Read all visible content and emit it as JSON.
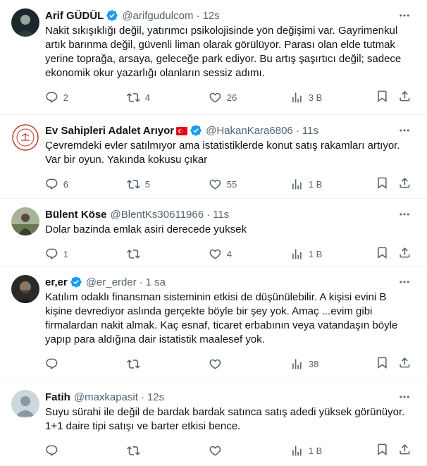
{
  "tweets": [
    {
      "name": "Arif GÜDÜL",
      "handle": "@arifgudulcom",
      "time": "12s",
      "verified": true,
      "text": "Nakit sıkışıklığı değil, yatırımcı psikolojisinde yön değişimi var. Gayrimenkul artık barınma değil, güvenli liman olarak görülüyor. Parası olan elde tutmak yerine toprağa, arsaya, geleceğe park ediyor. Bu artış şaşırtıcı değil; sadece ekonomik okur yazarlığı olanların sessiz adımı.",
      "replies": "2",
      "retweets": "4",
      "likes": "26",
      "views": "3 B"
    },
    {
      "name": "Ev Sahipleri Adalet Arıyor",
      "handle": "@HakanKara6806",
      "time": "11s",
      "verified": true,
      "text": "Çevremdeki evler satılmıyor ama istatistiklerde konut satış rakamları artıyor. Var bir oyun. Yakında kokusu çıkar",
      "replies": "6",
      "retweets": "5",
      "likes": "55",
      "views": "1 B"
    },
    {
      "name": "Bülent Köse",
      "handle": "@BlentKs30611966",
      "time": "11s",
      "verified": false,
      "text": "Dolar bazinda emlak asiri derecede yuksek",
      "replies": "1",
      "retweets": "",
      "likes": "4",
      "views": "1 B"
    },
    {
      "name": "er,er",
      "handle": "@er_erder",
      "time": "1 sa",
      "verified": true,
      "text": "Katılım odaklı finansman sisteminin etkisi de düşünülebilir. A kişisi evini B kişine devrediyor aslında gerçekte böyle bir şey yok. Amaç ...evim gibi firmalardan nakit almak. Kaç esnaf, ticaret erbabının veya vatandaşın böyle yapıp para aldığına dair istatistik maalesef yok.",
      "replies": "",
      "retweets": "",
      "likes": "",
      "views": "38"
    },
    {
      "name": "Fatih",
      "handle": "@maxkapasit",
      "time": "12s",
      "verified": false,
      "text": "Suyu sürahi ile değil de bardak bardak satınca satış adedi yüksek görünüyor. 1+1 daire tipi satışı ve barter etkisi bence.",
      "replies": "",
      "retweets": "",
      "likes": "",
      "views": "1 B"
    }
  ],
  "colors": {
    "verified": "#1d9bf0",
    "secondary": "#536471",
    "text": "#0f1419",
    "divider": "#eff3f4"
  }
}
